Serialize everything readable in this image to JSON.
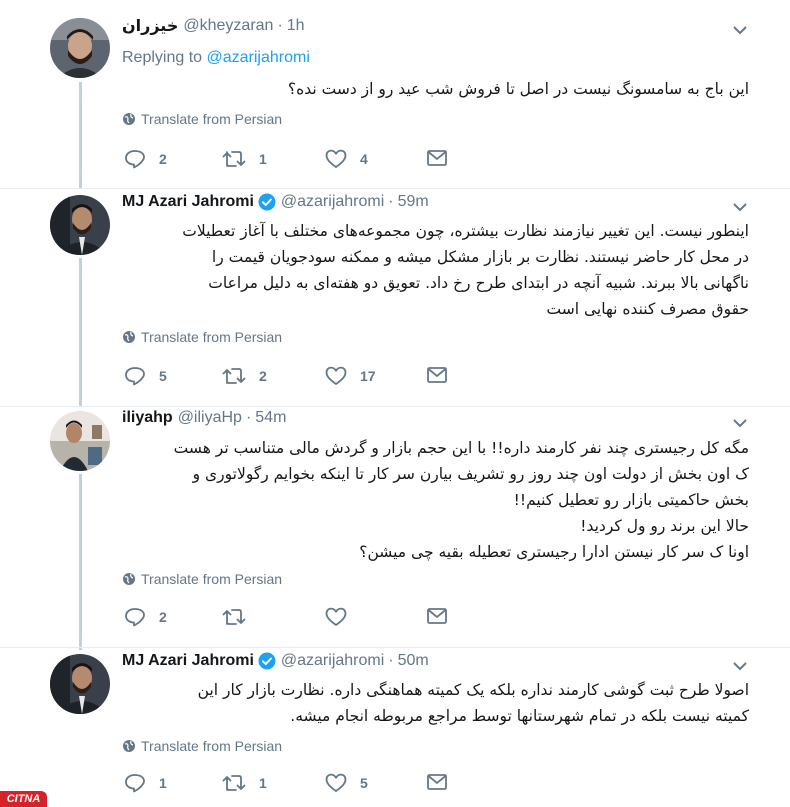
{
  "colors": {
    "accent": "#1da1f2",
    "muted": "#657786",
    "text": "#14171a",
    "line": "#c4cfd6",
    "verified": "#1da1f2",
    "logo_bg": "#d8222a"
  },
  "tweets": [
    {
      "display_name": "خیزران",
      "handle": "@kheyzaran",
      "time": "1h",
      "verified": false,
      "replying_prefix": "Replying to",
      "replying_to": "@azarijahromi",
      "text": "این باج به سامسونگ نیست در اصل تا فروش شب عید رو از دست نده؟",
      "translate": "Translate from Persian",
      "replies": "2",
      "retweets": "1",
      "likes": "4"
    },
    {
      "display_name": "MJ Azari Jahromi",
      "handle": "@azarijahromi",
      "time": "59m",
      "verified": true,
      "text_lines": [
        "اینطور نیست. این تغییر نیازمند نظارت بیشتره، چون مجموعه‌های مختلف با آغاز تعطیلات",
        "در محل کار حاضر نیستند. نظارت بر بازار مشکل میشه و ممکنه سودجویان قیمت را",
        "ناگهانی بالا ببرند. شبیه آنچه در ابتدای طرح رخ داد. تعویق دو هفته‌ای به دلیل مراعات",
        "حقوق مصرف کننده نهایی است"
      ],
      "translate": "Translate from Persian",
      "replies": "5",
      "retweets": "2",
      "likes": "17"
    },
    {
      "display_name": "iliyahp",
      "handle": "@iliyaHp",
      "time": "54m",
      "verified": false,
      "text_lines": [
        "مگه کل رجیستری چند نفر کارمند داره!! با این حجم بازار و گردش مالی متناسب تر هست",
        "ک اون بخش از دولت اون چند روز رو تشریف بیارن سر کار تا اینکه بخوایم رگولاتوری و",
        "بخش حاکمیتی بازار رو تعطیل کنیم!!",
        "حالا این برند رو ول کردید!",
        "اونا ک سر کار نیستن ادارا رجیستری تعطیله بقیه چی میشن؟"
      ],
      "translate": "Translate from Persian",
      "replies": "2",
      "retweets": "",
      "likes": ""
    },
    {
      "display_name": "MJ Azari Jahromi",
      "handle": "@azarijahromi",
      "time": "50m",
      "verified": true,
      "text_lines": [
        "اصولا طرح ثبت گوشی کارمند نداره بلکه یک کمیته هماهنگی داره. نظارت بازار کار این",
        "کمیته نیست بلکه در تمام شهرستانها توسط مراجع مربوطه انجام میشه."
      ],
      "translate": "Translate from Persian",
      "replies": "1",
      "retweets": "1",
      "likes": "5"
    }
  ],
  "watermark": "CITNA",
  "icons": [
    "chevron-down-icon",
    "globe-icon",
    "reply-icon",
    "retweet-icon",
    "heart-icon",
    "envelope-icon",
    "verified-badge-icon"
  ]
}
